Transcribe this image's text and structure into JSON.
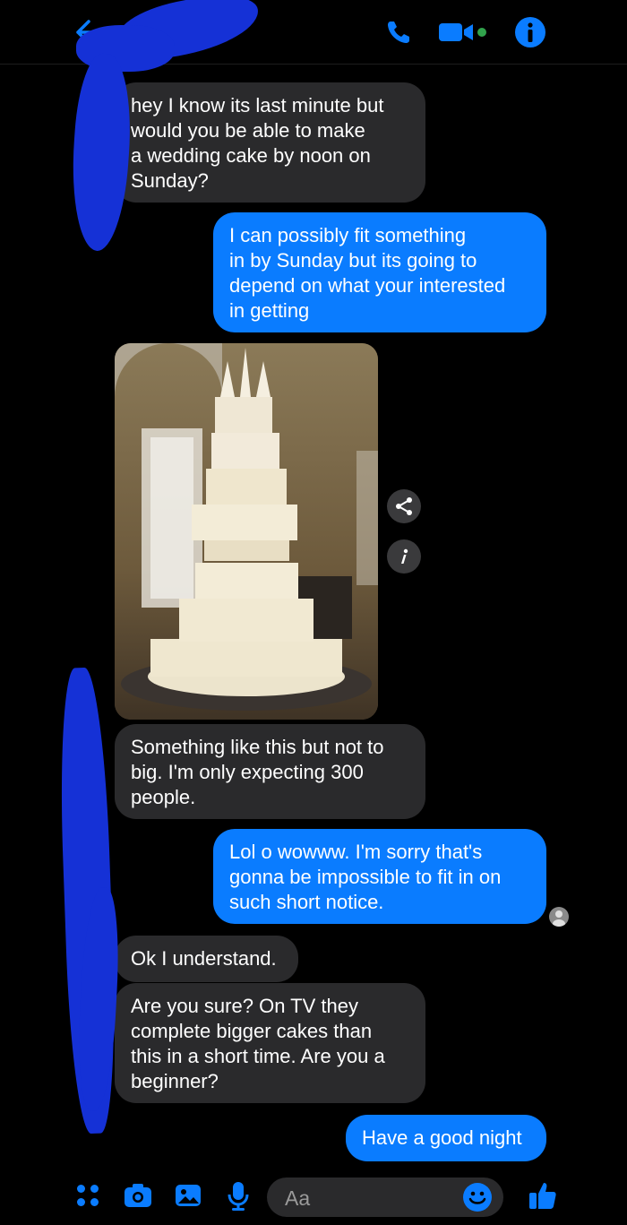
{
  "header": {
    "icons": [
      "back-arrow-icon",
      "phone-icon",
      "video-camera-icon",
      "info-icon"
    ],
    "accent": "#0a7cff"
  },
  "messages": [
    {
      "sender": "them",
      "text": "hey I know its last minute but\nwould you be able to make\na wedding cake by noon on\nSunday?"
    },
    {
      "sender": "me",
      "text": "I can possibly fit something\nin by Sunday but its going to\ndepend on what your interested\nin getting"
    },
    {
      "sender": "them",
      "type": "photo",
      "icon": "cake-photo"
    },
    {
      "sender": "them",
      "text": "Something like this but not to\nbig. I'm only expecting 300\npeople."
    },
    {
      "sender": "me",
      "text": "Lol o wowww. I'm sorry that's\ngonna be impossible to fit in on\nsuch short notice."
    },
    {
      "sender": "them",
      "text": "Ok I understand."
    },
    {
      "sender": "them",
      "text": "Are you sure?  On TV they\ncomplete bigger cakes than\nthis in a short time. Are you a\nbeginner?"
    },
    {
      "sender": "me",
      "text": "Have a good night"
    }
  ],
  "composer": {
    "placeholder": "Aa",
    "icons": [
      "menu-dots-icon",
      "camera-icon",
      "gallery-icon",
      "microphone-icon",
      "emoji-icon",
      "thumbs-up-icon"
    ]
  },
  "colors": {
    "outgoing": "#0a7cff",
    "incoming": "#2a2a2c",
    "background": "#000000",
    "redaction": "#1531d6"
  }
}
